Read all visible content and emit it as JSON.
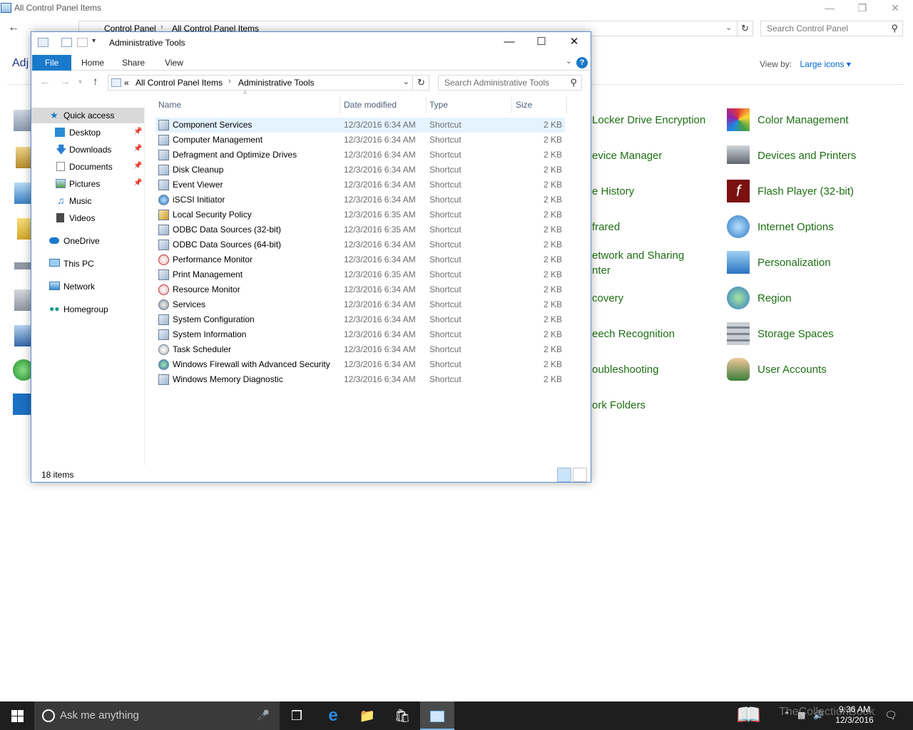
{
  "colors": {
    "accent": "#1979ca",
    "link_green": "#1e6f14",
    "heading_blue": "#1e3287",
    "selection": "#e5f3ff",
    "taskbar": "#1e1e1e"
  },
  "control_panel": {
    "window_title": "All Control Panel Items",
    "breadcrumb": [
      "Control Panel",
      "All Control Panel Items"
    ],
    "search_placeholder": "Search Control Panel",
    "heading_fragment": "Adj",
    "view_by_label": "View by:",
    "view_by_value": "Large icons",
    "items_middle": [
      "Locker Drive Encryption",
      "evice Manager",
      "e History",
      "frared",
      "etwork and Sharing",
      "nter",
      "covery",
      "eech Recognition",
      "oubleshooting",
      "ork Folders"
    ],
    "items_right": [
      {
        "label": "Color Management",
        "icon": "color-management-icon"
      },
      {
        "label": "Devices and Printers",
        "icon": "printer-icon"
      },
      {
        "label": "Flash Player (32-bit)",
        "icon": "flash-icon"
      },
      {
        "label": "Internet Options",
        "icon": "internet-options-icon"
      },
      {
        "label": "Personalization",
        "icon": "personalization-icon"
      },
      {
        "label": "Region",
        "icon": "region-icon"
      },
      {
        "label": "Storage Spaces",
        "icon": "storage-icon"
      },
      {
        "label": "User Accounts",
        "icon": "users-icon"
      }
    ]
  },
  "explorer": {
    "title": "Administrative Tools",
    "ribbon_tabs": [
      "File",
      "Home",
      "Share",
      "View"
    ],
    "address": {
      "overflow": "«",
      "crumbs": [
        "All Control Panel Items",
        "Administrative Tools"
      ]
    },
    "search_placeholder": "Search Administrative Tools",
    "sidebar": [
      {
        "label": "Quick access",
        "icon": "star-icon",
        "pinned": false,
        "selected": true
      },
      {
        "label": "Desktop",
        "icon": "desktop-icon",
        "pinned": true
      },
      {
        "label": "Downloads",
        "icon": "download-icon",
        "pinned": true
      },
      {
        "label": "Documents",
        "icon": "documents-icon",
        "pinned": true
      },
      {
        "label": "Pictures",
        "icon": "pictures-icon",
        "pinned": true
      },
      {
        "label": "Music",
        "icon": "music-icon",
        "pinned": false
      },
      {
        "label": "Videos",
        "icon": "videos-icon",
        "pinned": false
      },
      {
        "label": "OneDrive",
        "icon": "cloud-icon",
        "pinned": false
      },
      {
        "label": "This PC",
        "icon": "computer-icon",
        "pinned": false
      },
      {
        "label": "Network",
        "icon": "network-icon",
        "pinned": false
      },
      {
        "label": "Homegroup",
        "icon": "homegroup-icon",
        "pinned": false
      }
    ],
    "columns": [
      "Name",
      "Date modified",
      "Type",
      "Size"
    ],
    "files": [
      {
        "name": "Component Services",
        "date": "12/3/2016 6:34 AM",
        "type": "Shortcut",
        "size": "2 KB"
      },
      {
        "name": "Computer Management",
        "date": "12/3/2016 6:34 AM",
        "type": "Shortcut",
        "size": "2 KB"
      },
      {
        "name": "Defragment and Optimize Drives",
        "date": "12/3/2016 6:34 AM",
        "type": "Shortcut",
        "size": "2 KB"
      },
      {
        "name": "Disk Cleanup",
        "date": "12/3/2016 6:34 AM",
        "type": "Shortcut",
        "size": "2 KB"
      },
      {
        "name": "Event Viewer",
        "date": "12/3/2016 6:34 AM",
        "type": "Shortcut",
        "size": "2 KB"
      },
      {
        "name": "iSCSI Initiator",
        "date": "12/3/2016 6:34 AM",
        "type": "Shortcut",
        "size": "2 KB"
      },
      {
        "name": "Local Security Policy",
        "date": "12/3/2016 6:35 AM",
        "type": "Shortcut",
        "size": "2 KB"
      },
      {
        "name": "ODBC Data Sources (32-bit)",
        "date": "12/3/2016 6:35 AM",
        "type": "Shortcut",
        "size": "2 KB"
      },
      {
        "name": "ODBC Data Sources (64-bit)",
        "date": "12/3/2016 6:34 AM",
        "type": "Shortcut",
        "size": "2 KB"
      },
      {
        "name": "Performance Monitor",
        "date": "12/3/2016 6:34 AM",
        "type": "Shortcut",
        "size": "2 KB"
      },
      {
        "name": "Print Management",
        "date": "12/3/2016 6:35 AM",
        "type": "Shortcut",
        "size": "2 KB"
      },
      {
        "name": "Resource Monitor",
        "date": "12/3/2016 6:34 AM",
        "type": "Shortcut",
        "size": "2 KB"
      },
      {
        "name": "Services",
        "date": "12/3/2016 6:34 AM",
        "type": "Shortcut",
        "size": "2 KB"
      },
      {
        "name": "System Configuration",
        "date": "12/3/2016 6:34 AM",
        "type": "Shortcut",
        "size": "2 KB"
      },
      {
        "name": "System Information",
        "date": "12/3/2016 6:34 AM",
        "type": "Shortcut",
        "size": "2 KB"
      },
      {
        "name": "Task Scheduler",
        "date": "12/3/2016 6:34 AM",
        "type": "Shortcut",
        "size": "2 KB"
      },
      {
        "name": "Windows Firewall with Advanced Security",
        "date": "12/3/2016 6:34 AM",
        "type": "Shortcut",
        "size": "2 KB"
      },
      {
        "name": "Windows Memory Diagnostic",
        "date": "12/3/2016 6:34 AM",
        "type": "Shortcut",
        "size": "2 KB"
      }
    ],
    "status": "18 items"
  },
  "taskbar": {
    "search_placeholder": "Ask me anything",
    "time": "9:36 AM",
    "date": "12/3/2016",
    "watermark": "TheCollectionBook"
  }
}
